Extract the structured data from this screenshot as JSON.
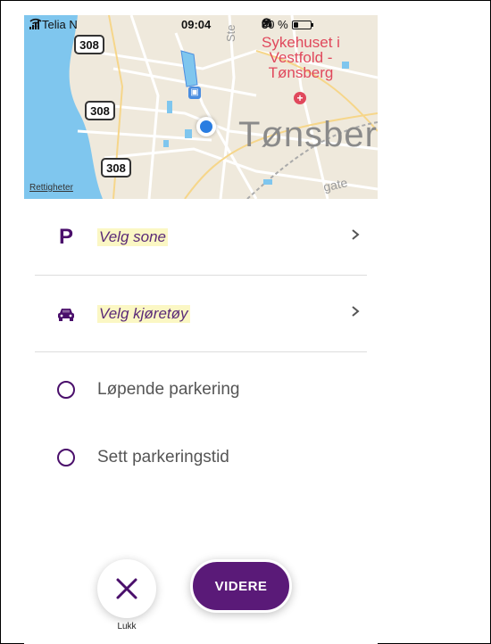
{
  "status_bar": {
    "carrier": "Telia N",
    "time": "09:04",
    "battery": "30 %",
    "battery_level": 0.3
  },
  "map": {
    "road_shields": [
      "308",
      "308",
      "308"
    ],
    "hospital_label": "Sykehuset i Vestfold - Tønsberg",
    "city_label": "Tønsberg",
    "street_top": "Ste",
    "street_bottom": "gate",
    "rights_link": "Rettigheter"
  },
  "list": {
    "zone_label": "Velg sone",
    "vehicle_label": "Velg kjøretøy",
    "option_continuous": "Løpende parkering",
    "option_set_time": "Sett parkeringstid"
  },
  "buttons": {
    "close_caption": "Lukk",
    "next_label": "VIDERE"
  },
  "colors": {
    "brand": "#4a0f6b",
    "button_bg": "#5a1a78",
    "highlight": "#fbf7c4",
    "hospital": "#e0485c",
    "location": "#2a7de1"
  },
  "icons": [
    "wifi-icon",
    "location-arrow-icon",
    "headphones-icon",
    "battery-icon",
    "hospital-icon",
    "bus-icon",
    "parking-icon",
    "car-icon",
    "chevron-right-icon",
    "close-icon"
  ]
}
